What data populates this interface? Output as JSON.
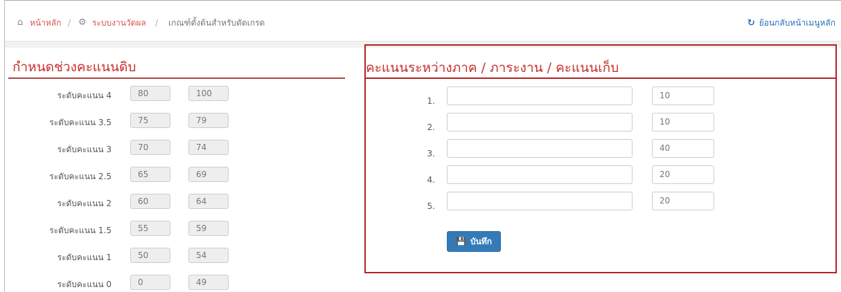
{
  "breadcrumb": {
    "home_icon": "home-icon",
    "home": "หน้าหลัก",
    "sep1": "/",
    "section_icon": "cogs-icon",
    "section": "ระบบงานวัดผล",
    "sep2": "/",
    "current": "เกณฑ์ตั้งต้นสำหรับตัดเกรด"
  },
  "back_link": {
    "icon": "undo-icon",
    "label": "ย้อนกลับหน้าเมนูหลัก"
  },
  "left_panel": {
    "title": "กำหนดช่วงคะแนนดิบ",
    "rows": [
      {
        "label": "ระดับคะแนน 4",
        "min": "80",
        "max": "100"
      },
      {
        "label": "ระดับคะแนน 3.5",
        "min": "75",
        "max": "79"
      },
      {
        "label": "ระดับคะแนน 3",
        "min": "70",
        "max": "74"
      },
      {
        "label": "ระดับคะแนน 2.5",
        "min": "65",
        "max": "69"
      },
      {
        "label": "ระดับคะแนน 2",
        "min": "60",
        "max": "64"
      },
      {
        "label": "ระดับคะแนน 1.5",
        "min": "55",
        "max": "59"
      },
      {
        "label": "ระดับคะแนน 1",
        "min": "50",
        "max": "54"
      },
      {
        "label": "ระดับคะแนน 0",
        "min": "0",
        "max": "49"
      }
    ]
  },
  "right_panel": {
    "title": "คะแนนระหว่างภาค / ภาระงาน / คะแนนเก็บ",
    "items": [
      {
        "num": "1.",
        "name": "",
        "score": "10"
      },
      {
        "num": "2.",
        "name": "",
        "score": "10"
      },
      {
        "num": "3.",
        "name": "",
        "score": "40"
      },
      {
        "num": "4.",
        "name": "",
        "score": "20"
      },
      {
        "num": "5.",
        "name": "",
        "score": "20"
      }
    ],
    "save_icon": "floppy-disk-icon",
    "save_label": "บันทึก"
  },
  "colors": {
    "accent_red": "#c9302c",
    "panel_border": "#b22222",
    "button_blue": "#337ab7",
    "link_blue": "#2a6fb8"
  }
}
